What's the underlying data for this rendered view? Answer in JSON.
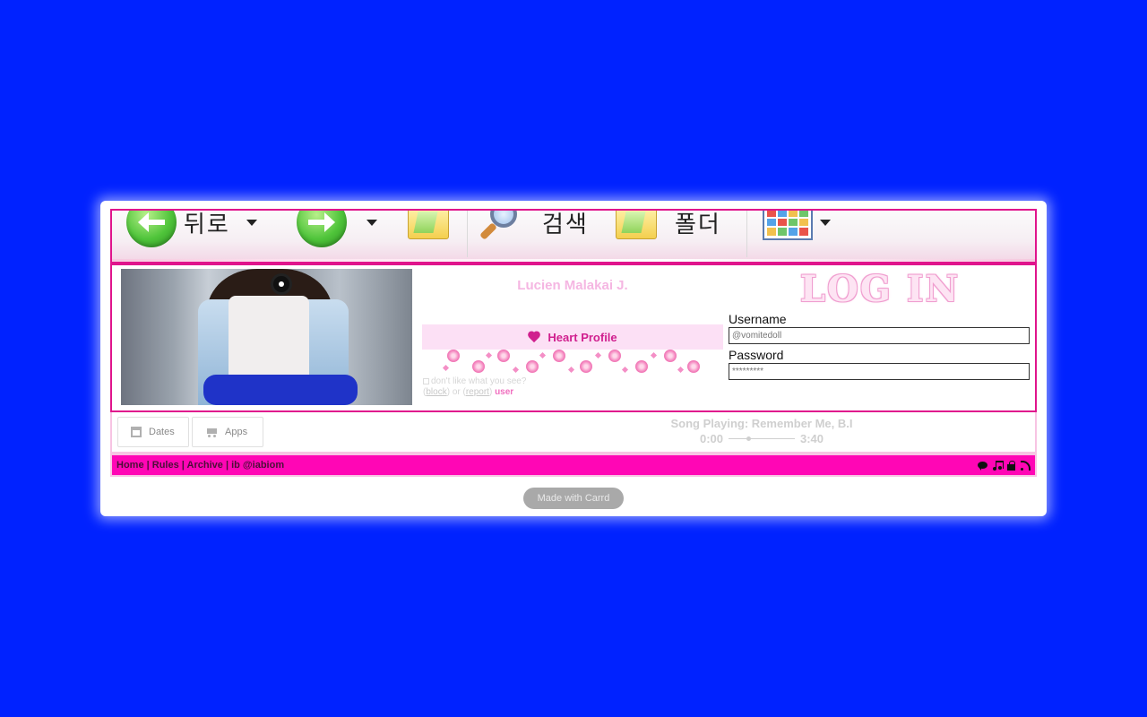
{
  "toolbar": {
    "back_label": "뒤로",
    "search_label": "검색",
    "folder_label": "폴더"
  },
  "profile": {
    "name": "Lucien Malakai J.",
    "heart_button": "Heart Profile",
    "report": {
      "question": "don't like what you see?",
      "block": "block",
      "or": "or",
      "report": "report",
      "user": "user"
    }
  },
  "login": {
    "title": "LOG IN",
    "username_label": "Username",
    "username_placeholder": "@vomitedoll",
    "password_label": "Password",
    "password_placeholder": "*********"
  },
  "nav": {
    "dates_label": "Dates",
    "apps_label": "Apps"
  },
  "song": {
    "label": "Song Playing: Remember Me, B.I",
    "current": "0:00",
    "duration": "3:40",
    "progress": 0.3
  },
  "footer": {
    "links": [
      "Home",
      "Rules",
      "Archive",
      "ib @iabiom"
    ],
    "separator": "|",
    "icons": [
      "chat-icon",
      "music-icon",
      "lock-icon",
      "rss-icon"
    ]
  },
  "made_with": "Made with Carrd",
  "colors": {
    "background": "#0022ff",
    "accent": "#ff06b5",
    "border": "#e0148c",
    "heart": "#d01f8e"
  }
}
